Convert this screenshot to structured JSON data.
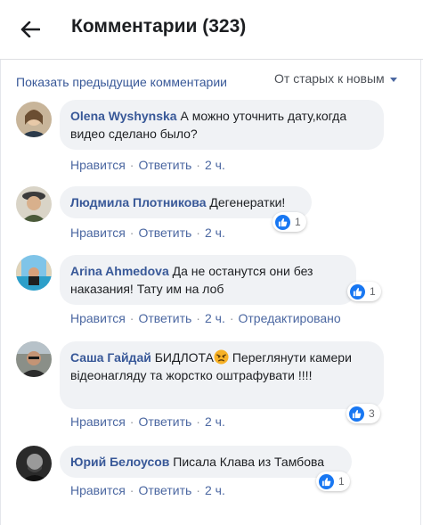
{
  "header": {
    "title": "Комментарии (323)"
  },
  "subbar": {
    "prev_link": "Показать предыдущие комментарии",
    "sort_label": "От старых к новым"
  },
  "actions": {
    "like": "Нравится",
    "reply": "Ответить"
  },
  "comments": [
    {
      "author": "Olena Wyshynska",
      "text": "А можно уточнить дату,когда видео сделано было?",
      "time": "2 ч.",
      "reactions": ""
    },
    {
      "author": "Людмила Плотникова",
      "text": "Дегенератки!",
      "time": "2 ч.",
      "reactions": "1"
    },
    {
      "author": "Arina Ahmedova",
      "text": "Да не останутся они без наказания! Тату им на лоб",
      "time": "2 ч.",
      "edited": "Отредактировано",
      "reactions": "1"
    },
    {
      "author": "Саша Гайдай",
      "text_before": "БИДЛОТА",
      "text_after": " Переглянути камери відеонагляду та жорстко оштрафувати !!!!",
      "time": "2 ч.",
      "reactions": "3",
      "emoji": "angry-face"
    },
    {
      "author": "Юрий Белоусов",
      "text": "Писала Клава из Тамбова",
      "time": "2 ч.",
      "reactions": "1"
    }
  ],
  "colors": {
    "link": "#385898",
    "bubble": "#f0f2f5",
    "like": "#1877f2",
    "angry": "#f7b125"
  }
}
